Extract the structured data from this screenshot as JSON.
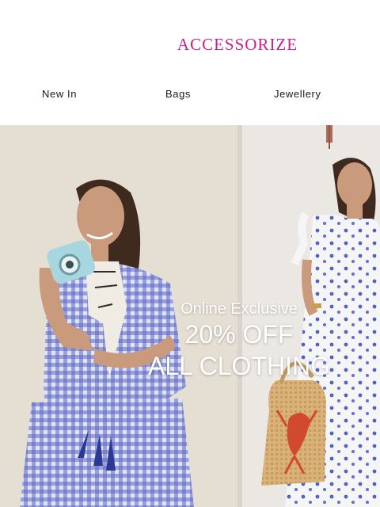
{
  "brand": {
    "name": "ACCESSORIZE",
    "color": "#cc1f8e"
  },
  "nav": {
    "items": [
      {
        "label": "New In"
      },
      {
        "label": "Bags"
      },
      {
        "label": "Jewellery"
      }
    ]
  },
  "hero": {
    "eyebrow": "Online Exclusive",
    "headline_line1": "20% OFF",
    "headline_line2": "ALL CLOTHING"
  }
}
